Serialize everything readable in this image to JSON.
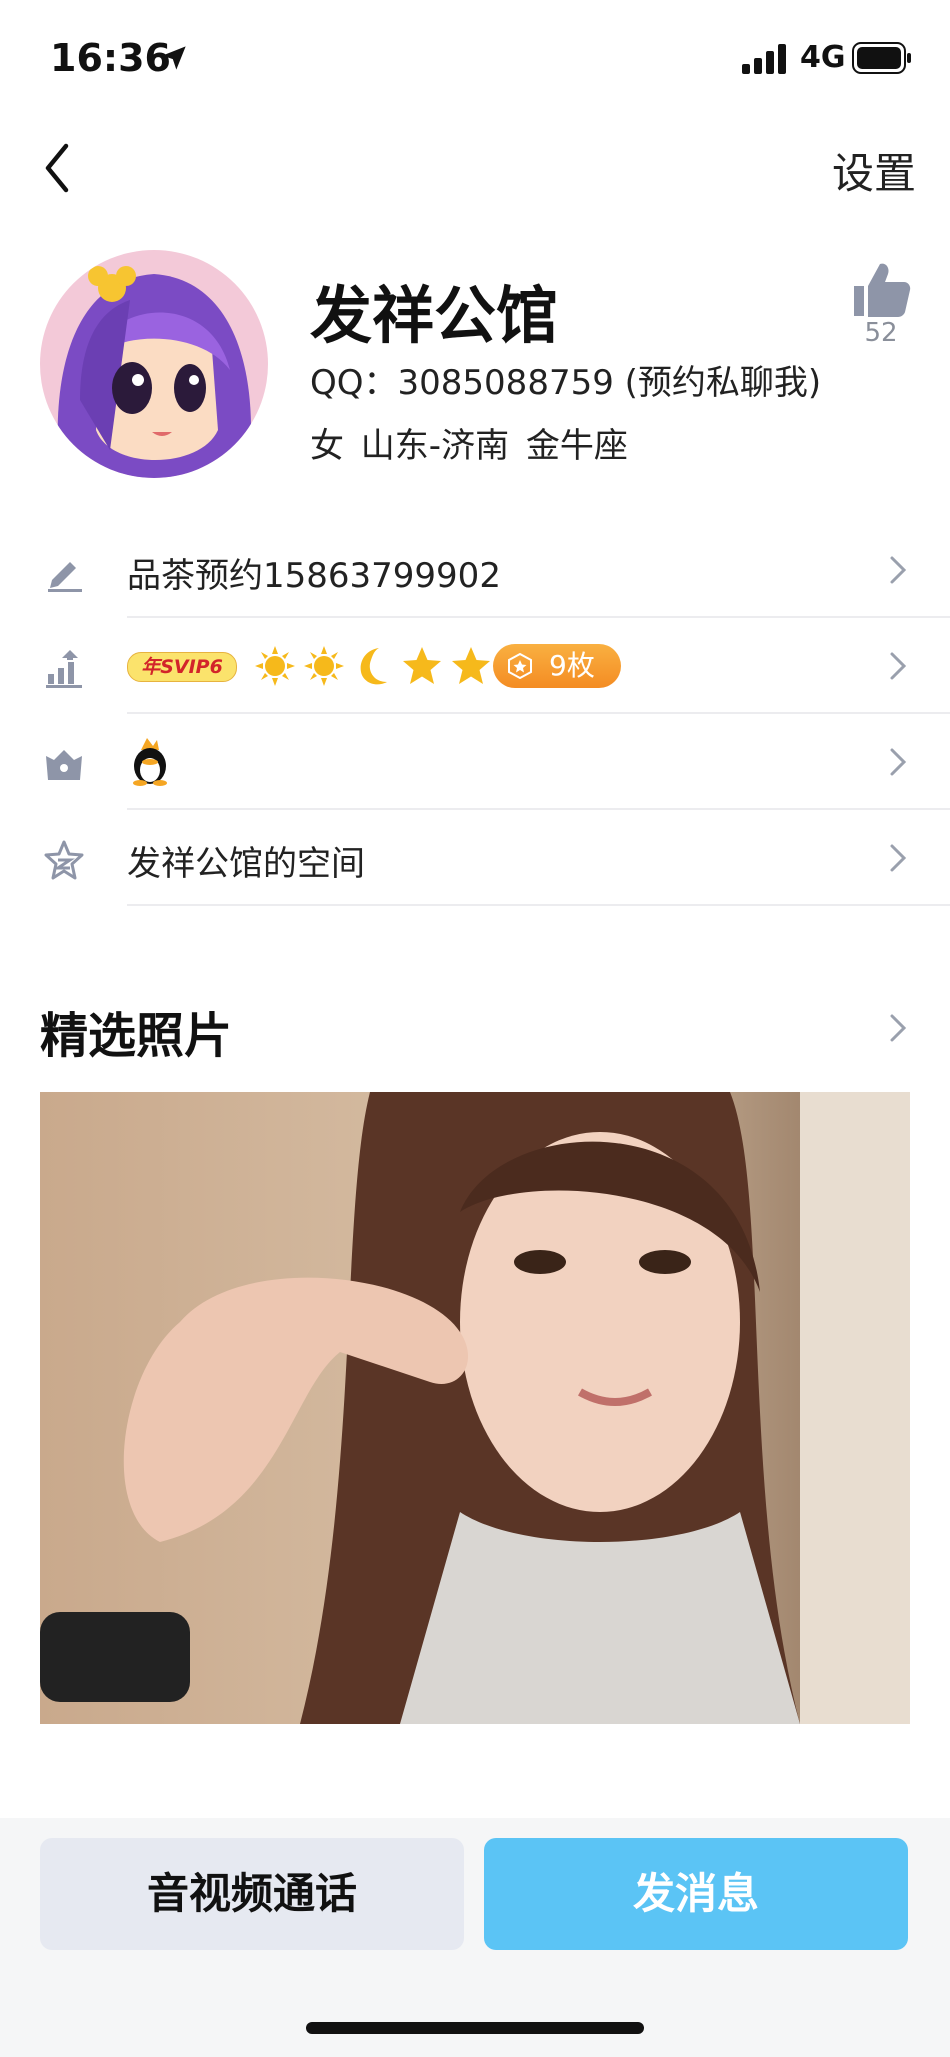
{
  "status_bar": {
    "time": "16:36",
    "network": "4G"
  },
  "nav": {
    "settings_label": "设置"
  },
  "profile": {
    "nickname": "发祥公馆",
    "qq_line": "QQ：3085088759 (预约私聊我)",
    "meta_line": "女  山东-济南  金牛座",
    "like_count": "52"
  },
  "rows": {
    "signature": "品茶预约15863799902",
    "svip_badge": "年SVIP6",
    "level_icons": [
      "sun-icon",
      "sun-icon",
      "moon-icon",
      "star-icon",
      "star-icon"
    ],
    "coin_count": "9枚",
    "space_label": "发祥公馆的空间"
  },
  "photos": {
    "section_title": "精选照片"
  },
  "actions": {
    "call_label": "音视频通话",
    "message_label": "发消息"
  },
  "colors": {
    "accent": "#5bc4f5",
    "call_bg": "#e6e9f1",
    "coin": "#f48c23"
  }
}
